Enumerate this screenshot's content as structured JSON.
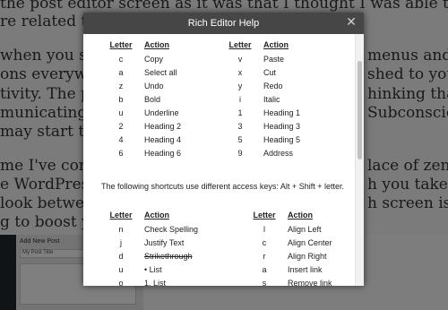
{
  "background": {
    "lines": [
      "the post editor screen as it was that I thought I was able to tune out all the extra",
      "re related to co",
      "when you spen",
      "ons everywhere",
      "tivity. The psyc",
      "municating you",
      "may start to fin",
      "me I've come to",
      "e WordPress u",
      "look between p",
      "g to boost your",
      "menus and",
      "shed to your",
      "hinking that",
      "Subconsciously",
      "lace of zen",
      "h you take a side-by-",
      "h screen is"
    ],
    "screenshot": {
      "page_title": "Add New Post",
      "post_title": "My Post Title"
    }
  },
  "dialog": {
    "title": "Rich Editor Help",
    "close_glyph": "✕",
    "header_letter": "Letter",
    "header_action": "Action",
    "table1": [
      {
        "l1": "c",
        "a1": "Copy",
        "l2": "v",
        "a2": "Paste"
      },
      {
        "l1": "a",
        "a1": "Select all",
        "l2": "x",
        "a2": "Cut"
      },
      {
        "l1": "z",
        "a1": "Undo",
        "l2": "y",
        "a2": "Redo"
      },
      {
        "l1": "b",
        "a1": "Bold",
        "l2": "i",
        "a2": "Italic"
      },
      {
        "l1": "u",
        "a1": "Underline",
        "l2": "1",
        "a2": "Heading 1"
      },
      {
        "l1": "2",
        "a1": "Heading 2",
        "l2": "3",
        "a2": "Heading 3"
      },
      {
        "l1": "4",
        "a1": "Heading 4",
        "l2": "5",
        "a2": "Heading 5"
      },
      {
        "l1": "6",
        "a1": "Heading 6",
        "l2": "9",
        "a2": "Address"
      }
    ],
    "note": "The following shortcuts use different access keys: Alt + Shift + letter.",
    "table2": [
      {
        "l1": "n",
        "a1": "Check Spelling",
        "l2": "l",
        "a2": "Align Left"
      },
      {
        "l1": "j",
        "a1": "Justify Text",
        "l2": "c",
        "a2": "Align Center"
      },
      {
        "l1": "d",
        "a1": "Strikethrough",
        "l2": "r",
        "a2": "Align Right"
      },
      {
        "l1": "u",
        "a1": "• List",
        "l2": "a",
        "a2": "Insert link"
      },
      {
        "l1": "o",
        "a1": "1. List",
        "l2": "s",
        "a2": "Remove link"
      }
    ]
  }
}
